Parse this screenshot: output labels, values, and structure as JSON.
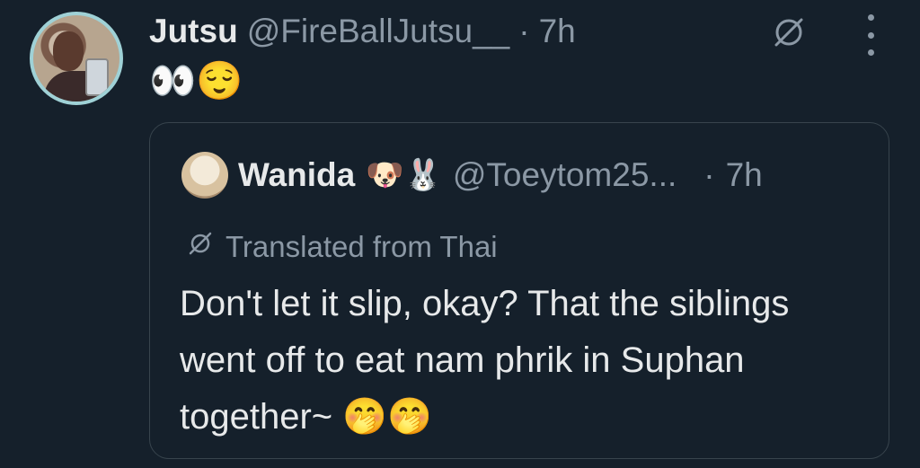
{
  "tweet": {
    "author_name": "Jutsu",
    "author_handle": "@FireBallJutsu__",
    "separator": "·",
    "time": "7h",
    "text": "👀😌"
  },
  "quoted": {
    "author_name": "Wanida",
    "name_emoji": "🐶🐰",
    "author_handle": "@Toeytom25...",
    "separator": "·",
    "time": "7h",
    "translated_label": "Translated from Thai",
    "text": "Don't let it slip, okay? That the siblings went off to eat nam phrik in Suphan together~ 🤭🤭"
  },
  "icons": {
    "translate": "translate-icon",
    "more": "more-options-icon"
  },
  "colors": {
    "background": "#15202b",
    "text": "#e7e9ea",
    "muted": "#8b98a5",
    "border": "#38444d"
  }
}
